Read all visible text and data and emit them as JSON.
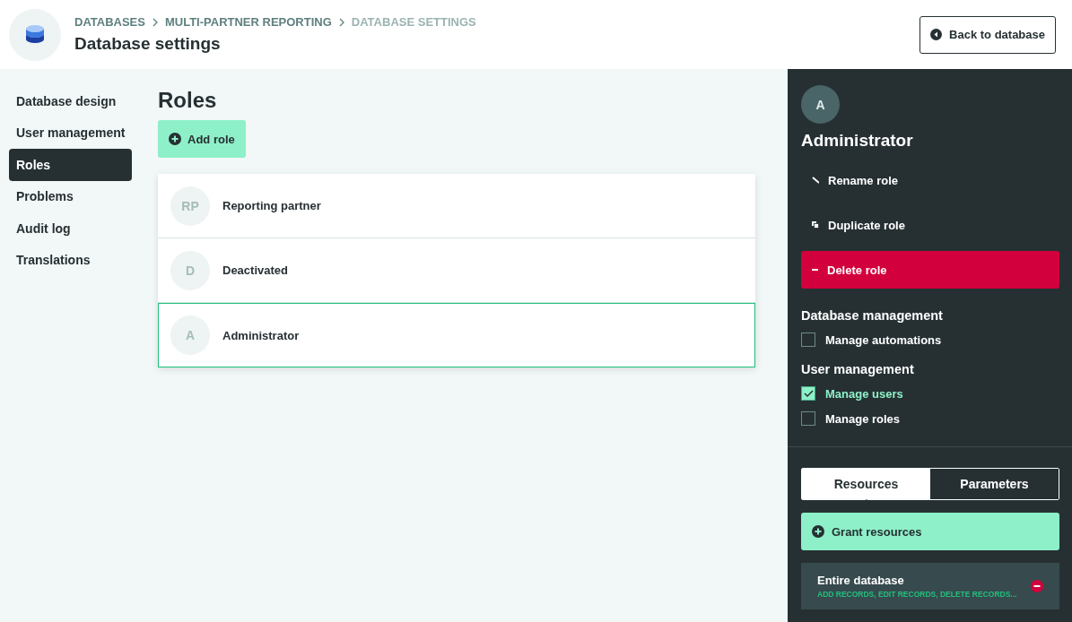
{
  "header": {
    "breadcrumbs": [
      {
        "label": "DATABASES",
        "current": false
      },
      {
        "label": "MULTI-PARTNER REPORTING",
        "current": false
      },
      {
        "label": "DATABASE SETTINGS",
        "current": true
      }
    ],
    "title": "Database settings",
    "back_button": "Back to database"
  },
  "nav": {
    "items": [
      {
        "label": "Database design",
        "selected": false
      },
      {
        "label": "User management",
        "selected": false
      },
      {
        "label": "Roles",
        "selected": true
      },
      {
        "label": "Problems",
        "selected": false
      },
      {
        "label": "Audit log",
        "selected": false
      },
      {
        "label": "Translations",
        "selected": false
      }
    ]
  },
  "roles": {
    "title": "Roles",
    "add_button": "Add role",
    "items": [
      {
        "initials": "RP",
        "name": "Reporting partner",
        "selected": false
      },
      {
        "initials": "D",
        "name": "Deactivated",
        "selected": false
      },
      {
        "initials": "A",
        "name": "Administrator",
        "selected": true
      }
    ]
  },
  "panel": {
    "avatar": "A",
    "name": "Administrator",
    "actions": [
      {
        "label": "Rename role",
        "kind": "rename"
      },
      {
        "label": "Duplicate role",
        "kind": "duplicate"
      },
      {
        "label": "Delete role",
        "kind": "delete"
      }
    ],
    "permission_groups": [
      {
        "title": "Database management",
        "permissions": [
          {
            "label": "Manage automations",
            "checked": false
          }
        ]
      },
      {
        "title": "User management",
        "permissions": [
          {
            "label": "Manage users",
            "checked": true
          },
          {
            "label": "Manage roles",
            "checked": false
          }
        ]
      }
    ],
    "tabs": [
      {
        "label": "Resources",
        "selected": true
      },
      {
        "label": "Parameters",
        "selected": false
      }
    ],
    "grant_button": "Grant resources",
    "resources": [
      {
        "name": "Entire database",
        "permissions": "ADD RECORDS, EDIT RECORDS, DELETE RECORDS..."
      }
    ]
  }
}
